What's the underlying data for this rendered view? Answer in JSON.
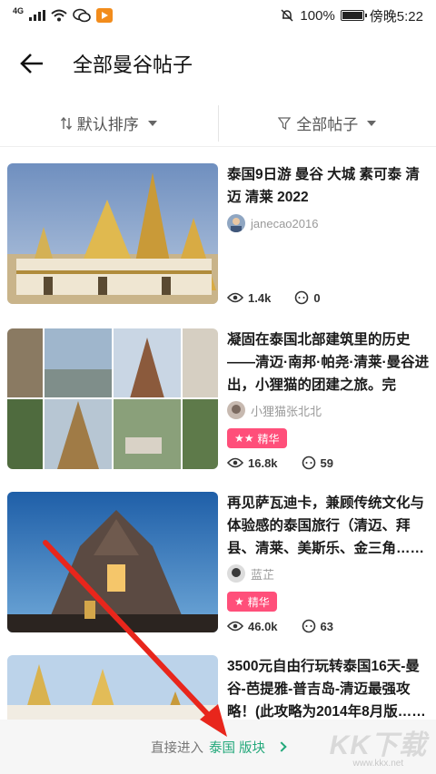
{
  "status_bar": {
    "network": "4G",
    "battery": "100%",
    "time": "傍晚5:22"
  },
  "header": {
    "title": "全部曼谷帖子"
  },
  "filters": {
    "sort_label": "默认排序",
    "type_label": "全部帖子"
  },
  "posts": [
    {
      "title": "泰国9日游 曼谷 大城 素可泰 清迈 清莱 2022",
      "author": "janecao2016",
      "badge": "",
      "views": "1.4k",
      "comments": "0"
    },
    {
      "title": "凝固在泰国北部建筑里的历史——清迈·南邦·帕尧·清莱·曼谷进出，小狸猫的团建之旅。完结……",
      "author": "小狸猫张北北",
      "badge": "精华",
      "views": "16.8k",
      "comments": "59"
    },
    {
      "title": "再见萨瓦迪卡，兼顾传统文化与体验感的泰国旅行（清迈、拜县、清莱、美斯乐、金三角……",
      "author": "蓝芷",
      "badge": "精华",
      "views": "46.0k",
      "comments": "63"
    },
    {
      "title": "3500元自由行玩转泰国16天-曼谷-芭提雅-普吉岛-清迈最强攻略！(此攻略为2014年8月版……",
      "author": "",
      "badge": "",
      "views": "",
      "comments": ""
    }
  ],
  "bottom_bar": {
    "prefix": "直接进入",
    "link": "泰国 版块"
  },
  "watermark": {
    "main": "KK下载",
    "sub": "www.kkx.net"
  },
  "colors": {
    "accent_green": "#22a87a",
    "badge_pink": "#ff4f7a",
    "annotation_red": "#e8261c"
  }
}
